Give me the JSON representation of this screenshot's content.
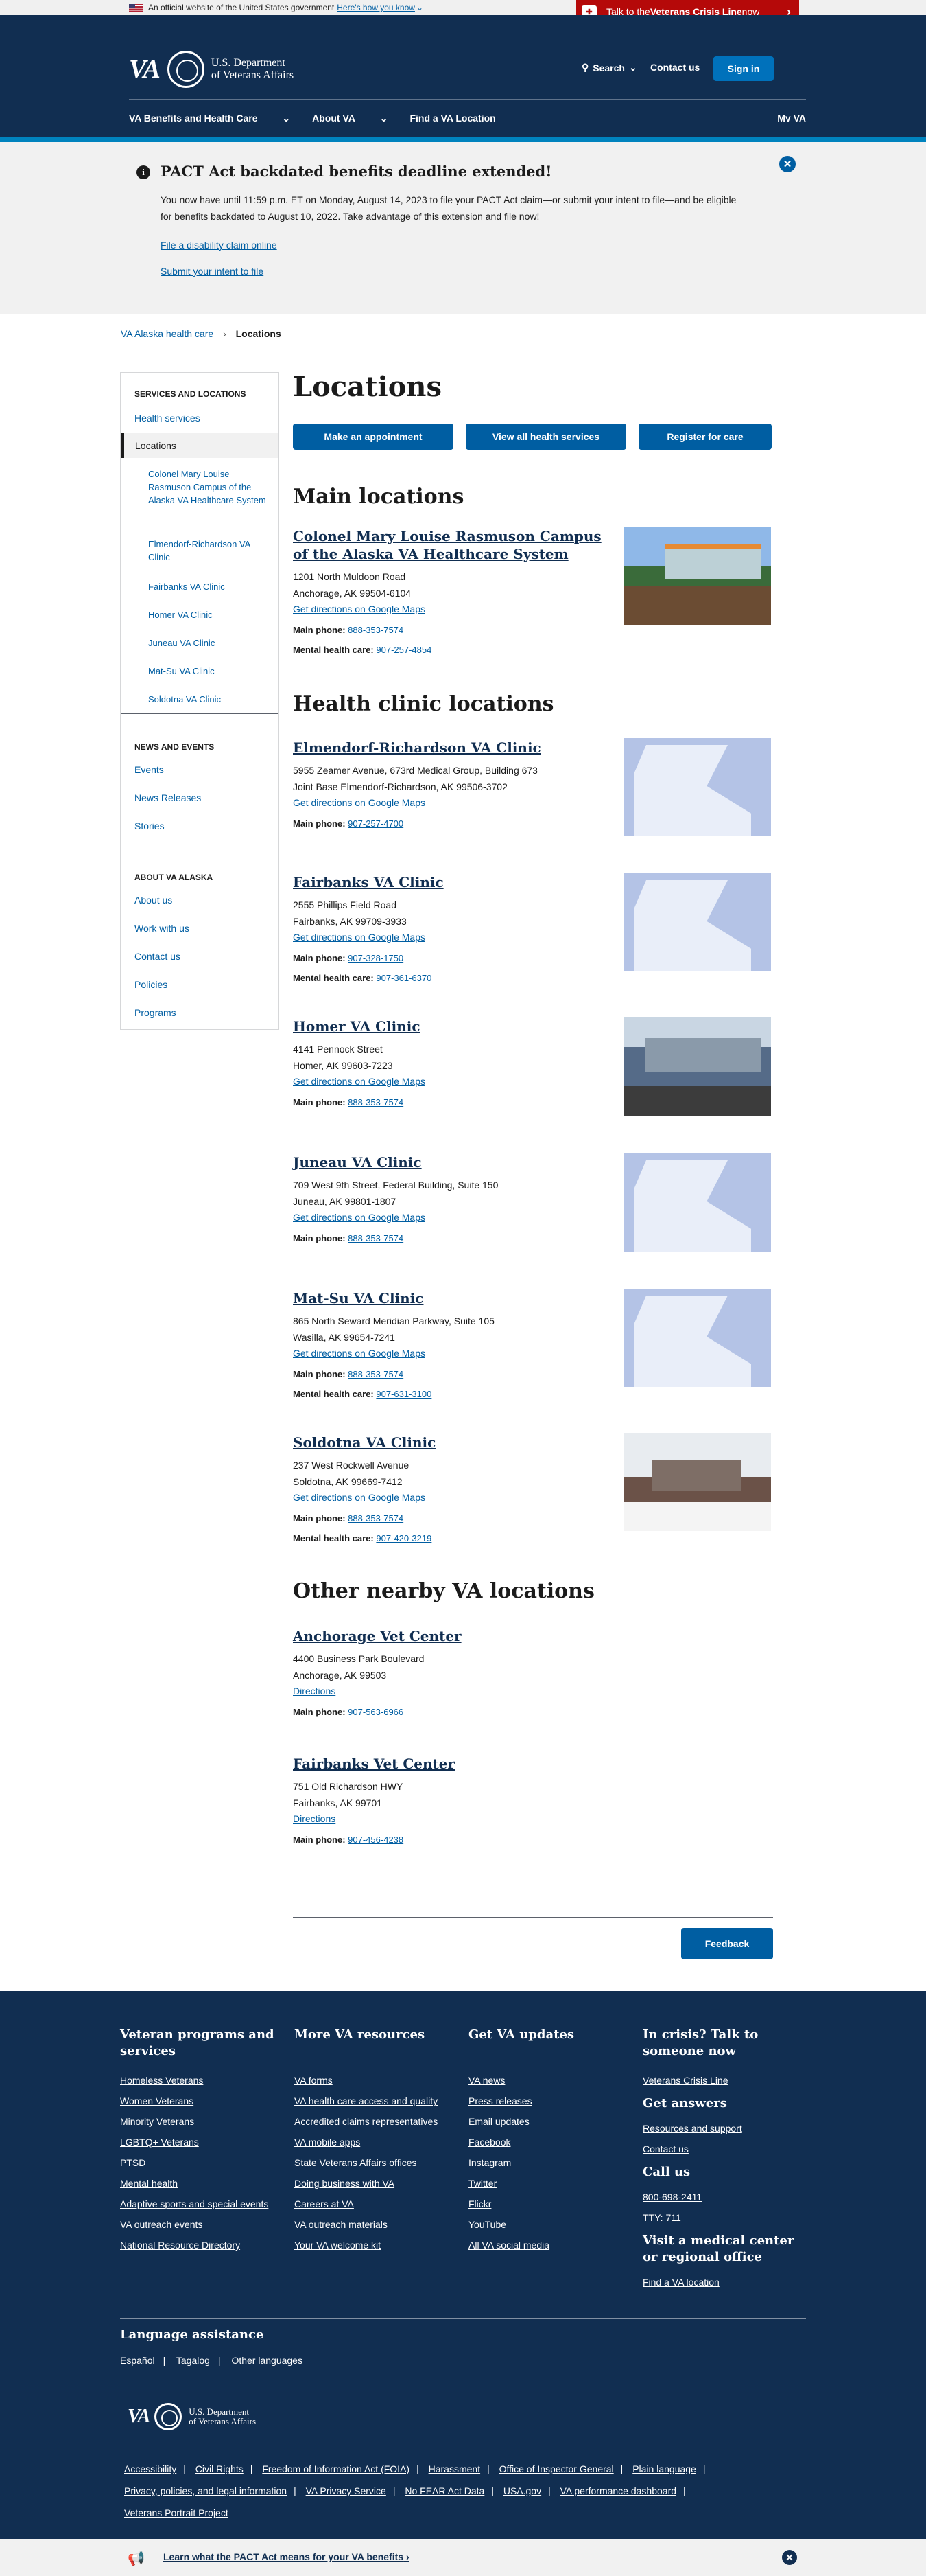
{
  "gov_banner": {
    "text": "An official website of the United States government",
    "link": "Here's how you know"
  },
  "crisis": {
    "label_pre": "Talk to the ",
    "label_bold": "Veterans Crisis Line",
    "label_post": " now"
  },
  "header": {
    "logo": "VA",
    "dept_line1": "U.S. Department",
    "dept_line2": "of Veterans Affairs",
    "search": "Search",
    "contact": "Contact us",
    "signin": "Sign in"
  },
  "nav": {
    "items": [
      "VA Benefits and Health Care",
      "About VA",
      "Find a VA Location"
    ],
    "myva": "My VA"
  },
  "alert": {
    "title": "PACT Act backdated benefits deadline extended!",
    "body": "You now have until 11:59 p.m. ET on Monday, August 14, 2023 to file your PACT Act claim—or submit your intent to file—and be eligible for benefits backdated to August 10, 2022. Take advantage of this extension and file now!",
    "link1": "File a disability claim online",
    "link2": "Submit your intent to file"
  },
  "breadcrumb": {
    "parent": "VA Alaska health care",
    "current": "Locations"
  },
  "sidebar": {
    "head1": "SERVICES AND LOCATIONS",
    "health_services": "Health services",
    "locations": "Locations",
    "subs": [
      "Colonel Mary Louise Rasmuson Campus of the Alaska VA Healthcare System",
      "Elmendorf-Richardson VA Clinic",
      "Fairbanks VA Clinic",
      "Homer VA Clinic",
      "Juneau VA Clinic",
      "Mat-Su VA Clinic",
      "Soldotna VA Clinic"
    ],
    "head2": "NEWS AND EVENTS",
    "news": [
      "Events",
      "News Releases",
      "Stories"
    ],
    "head3": "ABOUT VA ALASKA",
    "about": [
      "About us",
      "Work with us",
      "Contact us",
      "Policies",
      "Programs"
    ]
  },
  "main": {
    "title": "Locations",
    "buttons": [
      "Make an appointment",
      "View all health services",
      "Register for care"
    ],
    "sections": [
      "Main locations",
      "Health clinic locations",
      "Other nearby VA locations"
    ],
    "directions": "Get directions on Google Maps",
    "directions_short": "Directions",
    "main_phone_label": "Main phone:",
    "mental_label": "Mental health care:",
    "locations": [
      {
        "name": "Colonel Mary Louise Rasmuson Campus of the Alaska VA Healthcare System",
        "addr1": "1201 North Muldoon Road",
        "addr2": "Anchorage, AK 99504-6104",
        "phone": "888-353-7574",
        "mental": "907-257-4854"
      },
      {
        "name": "Elmendorf-Richardson VA Clinic",
        "addr1": "5955 Zeamer Avenue, 673rd Medical Group, Building 673",
        "addr2": "Joint Base Elmendorf-Richardson, AK 99506-3702",
        "phone": "907-257-4700"
      },
      {
        "name": "Fairbanks VA Clinic",
        "addr1": "2555 Phillips Field Road",
        "addr2": "Fairbanks, AK 99709-3933",
        "phone": "907-328-1750",
        "mental": "907-361-6370"
      },
      {
        "name": "Homer VA Clinic",
        "addr1": "4141 Pennock Street",
        "addr2": "Homer, AK 99603-7223",
        "phone": "888-353-7574"
      },
      {
        "name": "Juneau VA Clinic",
        "addr1": "709 West 9th Street, Federal Building, Suite 150",
        "addr2": "Juneau, AK 99801-1807",
        "phone": "888-353-7574"
      },
      {
        "name": "Mat-Su VA Clinic",
        "addr1": "865 North Seward Meridian Parkway, Suite 105",
        "addr2": "Wasilla, AK 99654-7241",
        "phone": "888-353-7574",
        "mental": "907-631-3100"
      },
      {
        "name": "Soldotna VA Clinic",
        "addr1": "237 West Rockwell Avenue",
        "addr2": "Soldotna, AK 99669-7412",
        "phone": "888-353-7574",
        "mental": "907-420-3219"
      },
      {
        "name": "Anchorage Vet Center",
        "addr1": "4400 Business Park Boulevard",
        "addr2": "Anchorage, AK 99503",
        "phone": "907-563-6966"
      },
      {
        "name": "Fairbanks Vet Center",
        "addr1": "751 Old Richardson HWY",
        "addr2": "Fairbanks, AK 99701",
        "phone": "907-456-4238"
      }
    ],
    "feedback": "Feedback"
  },
  "footer": {
    "col1": {
      "title": "Veteran programs and services",
      "links": [
        "Homeless Veterans",
        "Women Veterans",
        "Minority Veterans",
        "LGBTQ+ Veterans",
        "PTSD",
        "Mental health",
        "Adaptive sports and special events",
        "VA outreach events",
        "National Resource Directory"
      ]
    },
    "col2": {
      "title": "More VA resources",
      "links": [
        "VA forms",
        "VA health care access and quality",
        "Accredited claims representatives",
        "VA mobile apps",
        "State Veterans Affairs offices",
        "Doing business with VA",
        "Careers at VA",
        "VA outreach materials",
        "Your VA welcome kit"
      ]
    },
    "col3": {
      "title": "Get VA updates",
      "links": [
        "VA news",
        "Press releases",
        "Email updates",
        "Facebook",
        "Instagram",
        "Twitter",
        "Flickr",
        "YouTube",
        "All VA social media"
      ]
    },
    "col4": {
      "title": "In crisis? Talk to someone now",
      "crisis_link": "Veterans Crisis Line",
      "answers_title": "Get answers",
      "answers": [
        "Resources and support",
        "Contact us"
      ],
      "call_title": "Call us",
      "phones": [
        "800-698-2411",
        "TTY: 711"
      ],
      "visit_title": "Visit a medical center or regional office",
      "visit_link": "Find a VA location"
    },
    "lang_title": "Language assistance",
    "langs": [
      "Español",
      "Tagalog",
      "Other languages"
    ],
    "legal": [
      "Accessibility",
      "Civil Rights",
      "Freedom of Information Act (FOIA)",
      "Harassment",
      "Office of Inspector General",
      "Plain language",
      "Privacy, policies, and legal information",
      "VA Privacy Service",
      "No FEAR Act Data",
      "USA.gov",
      "VA performance dashboard",
      "Veterans Portrait Project"
    ]
  },
  "pact_bar": "Learn what the PACT Act means for your VA benefits"
}
